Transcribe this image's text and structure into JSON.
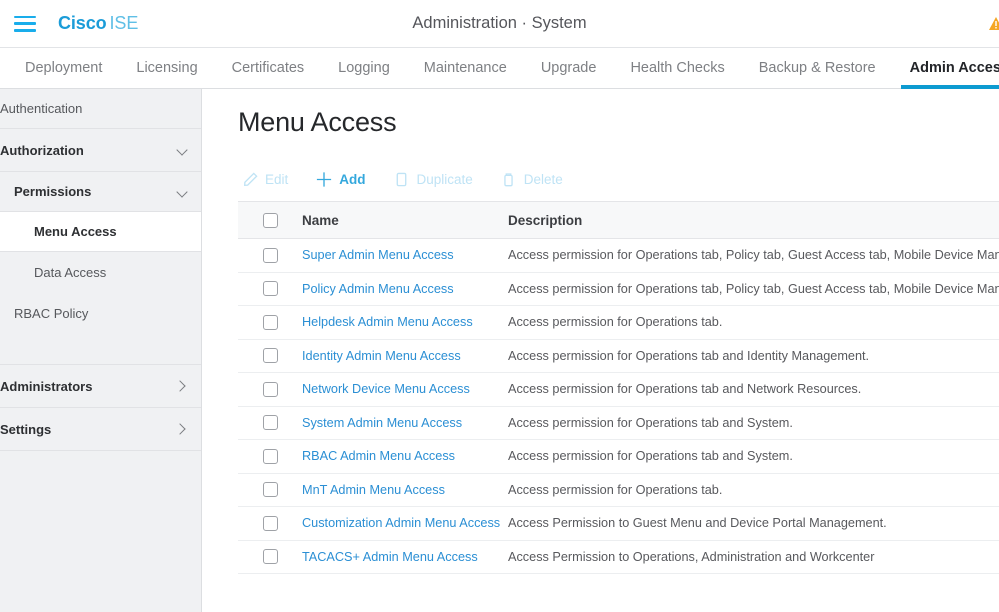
{
  "header": {
    "menu_icon": "hamburger-icon",
    "brand_primary": "Cisco",
    "brand_secondary": "ISE",
    "breadcrumb": "Administration · System",
    "warning_icon": "warning-icon",
    "accent_blue": "#1b9cd8"
  },
  "tabs": [
    {
      "label": "Deployment",
      "active": false
    },
    {
      "label": "Licensing",
      "active": false
    },
    {
      "label": "Certificates",
      "active": false
    },
    {
      "label": "Logging",
      "active": false
    },
    {
      "label": "Maintenance",
      "active": false
    },
    {
      "label": "Upgrade",
      "active": false
    },
    {
      "label": "Health Checks",
      "active": false
    },
    {
      "label": "Backup & Restore",
      "active": false
    },
    {
      "label": "Admin Access",
      "active": true
    }
  ],
  "sidebar": {
    "items": [
      {
        "label": "Authentication",
        "level": 0,
        "style": "plain",
        "chevron": "none",
        "selected": false
      },
      {
        "label": "Authorization",
        "level": 0,
        "style": "bold",
        "chevron": "down",
        "selected": false
      },
      {
        "label": "Permissions",
        "level": 1,
        "style": "bold",
        "chevron": "down",
        "selected": false
      },
      {
        "label": "Menu Access",
        "level": 2,
        "style": "bold",
        "chevron": "none",
        "selected": true
      },
      {
        "label": "Data Access",
        "level": 2,
        "style": "plain",
        "chevron": "none",
        "selected": false
      },
      {
        "label": "RBAC Policy",
        "level": 1,
        "style": "plain",
        "chevron": "none",
        "selected": false
      },
      {
        "label": "Administrators",
        "level": 0,
        "style": "bold",
        "chevron": "right",
        "selected": false
      },
      {
        "label": "Settings",
        "level": 0,
        "style": "bold",
        "chevron": "right",
        "selected": false
      }
    ]
  },
  "main": {
    "title": "Menu Access",
    "toolbar": [
      {
        "label": "Edit",
        "icon": "pencil-icon",
        "enabled": false
      },
      {
        "label": "Add",
        "icon": "plus-icon",
        "enabled": true
      },
      {
        "label": "Duplicate",
        "icon": "duplicate-icon",
        "enabled": false
      },
      {
        "label": "Delete",
        "icon": "trash-icon",
        "enabled": false
      }
    ],
    "table": {
      "columns": {
        "name": "Name",
        "description": "Description"
      },
      "rows": [
        {
          "name": "Super Admin Menu Access",
          "description": "Access permission for Operations tab, Policy tab, Guest Access tab, Mobile Device Management tab a"
        },
        {
          "name": "Policy Admin Menu Access",
          "description": "Access permission for Operations tab, Policy tab, Guest Access tab, Mobile Device Management tab,"
        },
        {
          "name": "Helpdesk Admin Menu Access",
          "description": "Access permission for Operations tab."
        },
        {
          "name": "Identity Admin Menu Access",
          "description": "Access permission for Operations tab and Identity Management."
        },
        {
          "name": "Network Device Menu Access",
          "description": "Access permission for Operations tab and Network Resources."
        },
        {
          "name": "System Admin Menu Access",
          "description": "Access permission for Operations tab and System."
        },
        {
          "name": "RBAC Admin Menu Access",
          "description": "Access permission for Operations tab and System."
        },
        {
          "name": "MnT Admin Menu Access",
          "description": "Access permission for Operations tab."
        },
        {
          "name": "Customization Admin Menu Access",
          "description": "Access Permission to Guest Menu and Device Portal Management."
        },
        {
          "name": "TACACS+ Admin Menu Access",
          "description": "Access Permission to Operations, Administration and Workcenter"
        }
      ]
    }
  }
}
